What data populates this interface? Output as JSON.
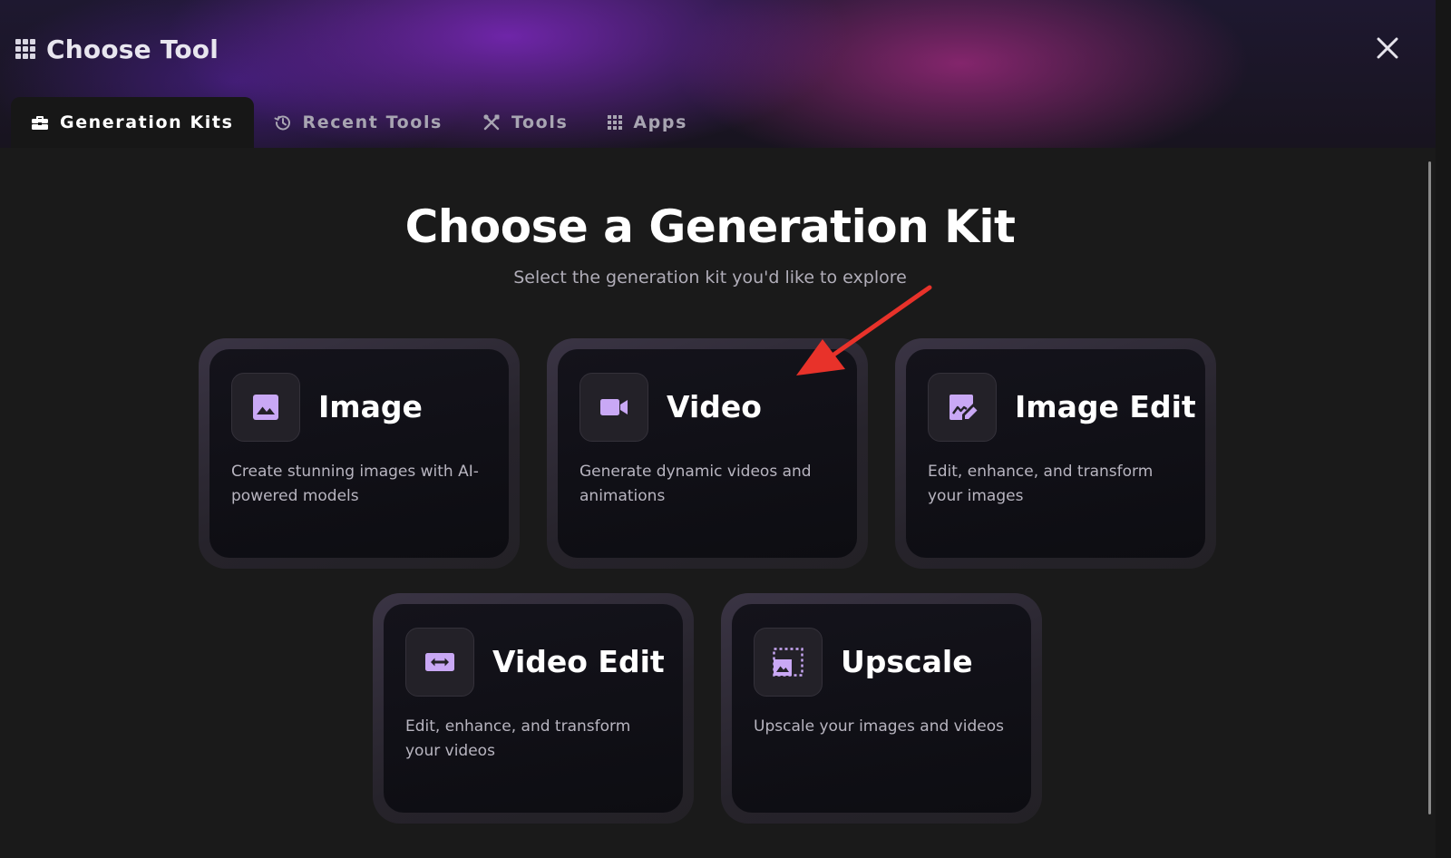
{
  "header": {
    "title": "Choose Tool",
    "icon": "grid-icon",
    "close_icon": "close-icon"
  },
  "tabs": [
    {
      "label": "Generation Kits",
      "icon": "toolbox-icon",
      "active": true
    },
    {
      "label": "Recent Tools",
      "icon": "history-icon",
      "active": false
    },
    {
      "label": "Tools",
      "icon": "tools-icon",
      "active": false
    },
    {
      "label": "Apps",
      "icon": "apps-grid-icon",
      "active": false
    }
  ],
  "main": {
    "title": "Choose a Generation Kit",
    "subtitle": "Select the generation kit you'd like to explore",
    "kits": [
      {
        "title": "Image",
        "description": "Create stunning images with AI-powered models",
        "icon": "image-icon"
      },
      {
        "title": "Video",
        "description": "Generate dynamic videos and animations",
        "icon": "video-camera-icon"
      },
      {
        "title": "Image Edit",
        "description": "Edit, enhance, and transform your images",
        "icon": "image-edit-icon"
      },
      {
        "title": "Video Edit",
        "description": "Edit, enhance, and transform your videos",
        "icon": "video-edit-icon"
      },
      {
        "title": "Upscale",
        "description": "Upscale your images and videos",
        "icon": "upscale-icon"
      }
    ]
  },
  "colors": {
    "accent": "#c9a8f5",
    "arrow": "#e8322a",
    "background": "#1a1a1a"
  }
}
